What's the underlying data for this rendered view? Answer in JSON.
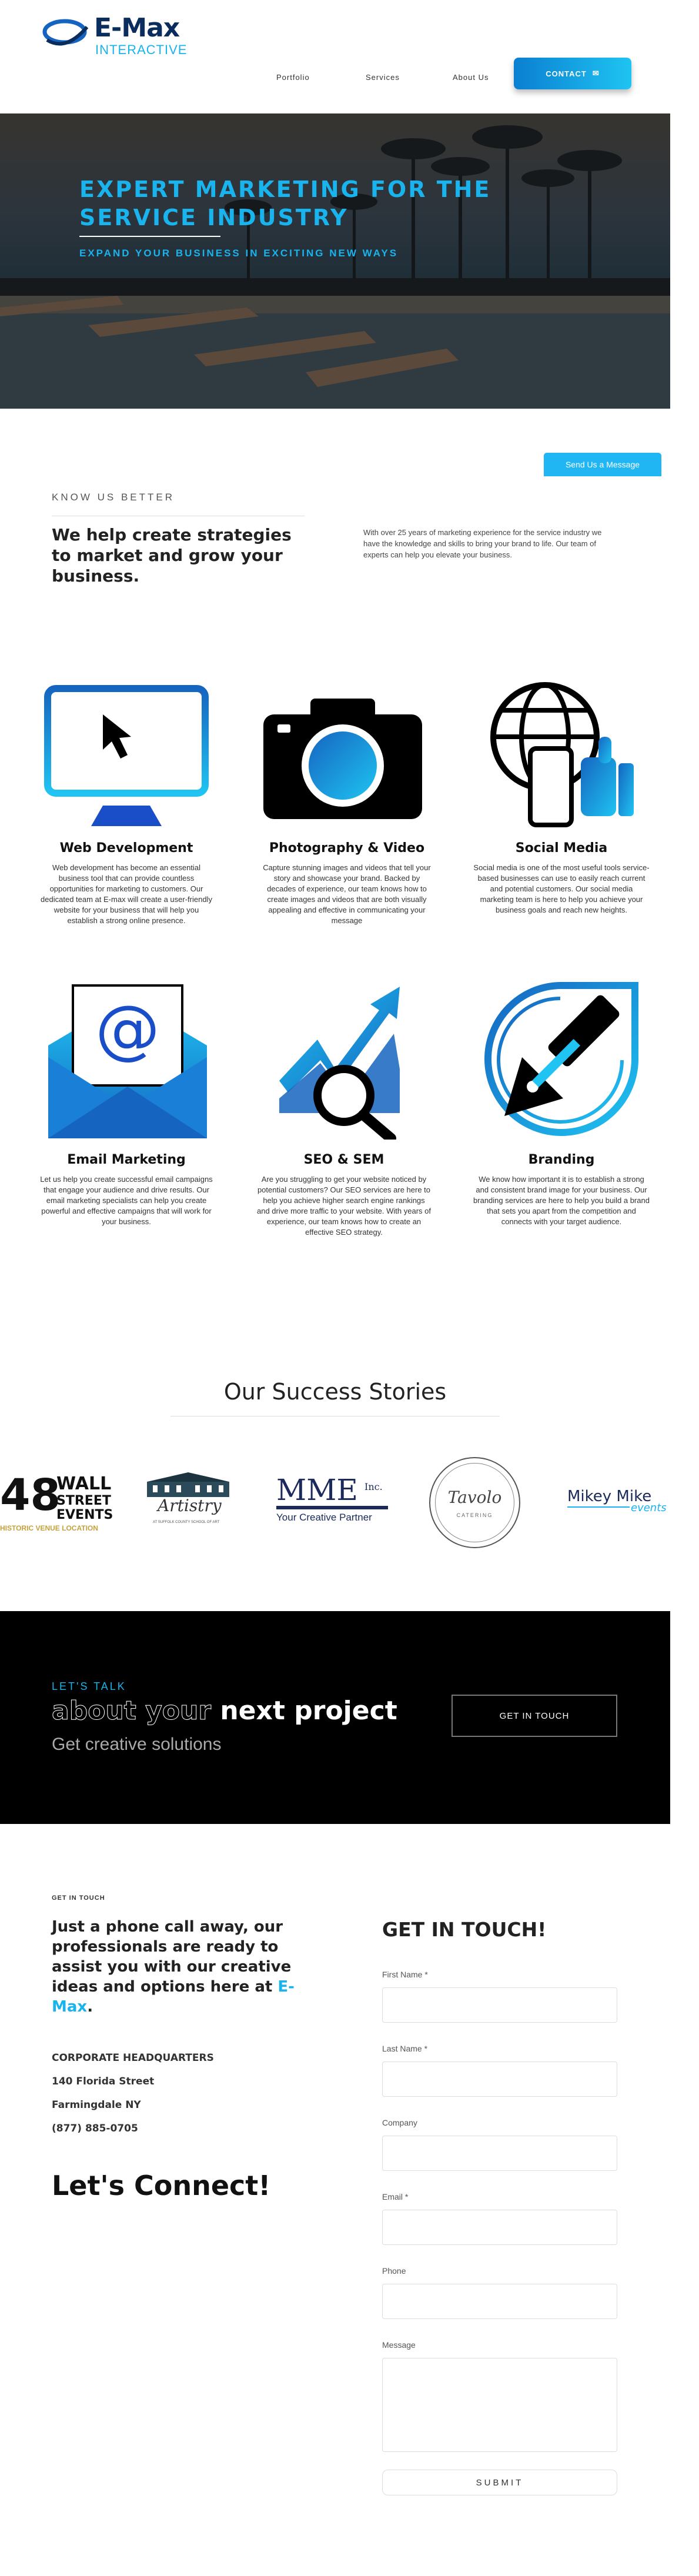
{
  "header": {
    "logo_title": "E-Max",
    "logo_subtitle": "INTERACTIVE",
    "nav": [
      "Portfolio",
      "Services",
      "About Us"
    ],
    "contact_label": "CONTACT"
  },
  "hero": {
    "title_line1": "EXPERT MARKETING FOR THE",
    "title_line2": "SERVICE INDUSTRY",
    "subtitle": "EXPAND YOUR BUSINESS IN EXCITING NEW WAYS"
  },
  "send_message_label": "Send Us a Message",
  "about": {
    "eyebrow": "KNOW US BETTER",
    "heading": "We help create strategies to market and grow your business.",
    "text": "With over 25 years of marketing experience for the service industry we have the knowledge and skills to bring your brand to life. Our team of experts can help you elevate your business."
  },
  "services": [
    {
      "title": "Web Development",
      "text": "Web development has become an essential business tool that can provide countless opportunities for marketing to customers. Our dedicated team at E-max will create a user-friendly website for your business that will help you establish a strong online presence."
    },
    {
      "title": "Photography & Video",
      "text": "Capture stunning images and videos that tell your story and showcase your brand. Backed by decades of experience, our team knows how to create images and videos that are both visually appealing and effective in communicating your message"
    },
    {
      "title": "Social Media",
      "text": "Social media is one of the most useful tools service-based businesses can use to easily reach current and potential customers. Our social media marketing team is here to help you achieve your business goals and reach new heights."
    },
    {
      "title": "Email Marketing",
      "text": "Let us help you create successful email campaigns that engage your audience and drive results. Our email marketing specialists can help you create powerful and effective campaigns that will work for your business."
    },
    {
      "title": "SEO & SEM",
      "text": "Are you struggling to get your website noticed by potential customers? Our SEO services are here to help you achieve higher search engine rankings and drive more traffic to your website. With years of experience, our team knows how to create an effective SEO strategy."
    },
    {
      "title": "Branding",
      "text": "We know how important it is to establish a strong and consistent brand image for your business. Our branding services are here to help you build a brand that sets you apart from the competition and connects with your target audience."
    }
  ],
  "success": {
    "heading": "Our Success Stories",
    "logos": {
      "wall_street_number": "48",
      "wall_street_line1": "WALL",
      "wall_street_line2": "STREET",
      "wall_street_line3": "EVENTS",
      "wall_street_tag": "HISTORIC VENUE LOCATION",
      "artistry": "Artistry",
      "artistry_tag": "AT SUFFOLK COUNTY SCHOOL OF ART",
      "mme": "MME",
      "mme_inc": "Inc.",
      "mme_tag": "Your Creative Partner",
      "tavolo": "Tavolo",
      "tavolo_tag": "CATERING",
      "mikey_mike": "Mikey Mike",
      "mikey_mike_tag": "events"
    }
  },
  "cta": {
    "eyebrow": "LET'S TALK",
    "heading_outline": "about your",
    "heading_bold": "next project",
    "subtext": "Get creative solutions",
    "button": "GET IN TOUCH"
  },
  "contact": {
    "eyebrow": "GET IN TOUCH",
    "intro": "Just a phone call away, our professionals are ready to assist you with our creative ideas and options here at",
    "intro_brand": "E-Max",
    "intro_end": ".",
    "hq_label": "CORPORATE HEADQUARTERS",
    "street": "140 Florida Street",
    "city": "Farmingdale NY",
    "phone": "(877) 885-0705",
    "lets_connect": "Let's Connect!",
    "form_title": "GET IN TOUCH!",
    "fields": [
      "First Name *",
      "Last Name *",
      "Company",
      "Email *",
      "Phone",
      "Message"
    ],
    "submit": "SUBMIT"
  },
  "colors": {
    "accent": "#19b3ee",
    "navy": "#0b2d5e",
    "blue": "#1565c0"
  }
}
